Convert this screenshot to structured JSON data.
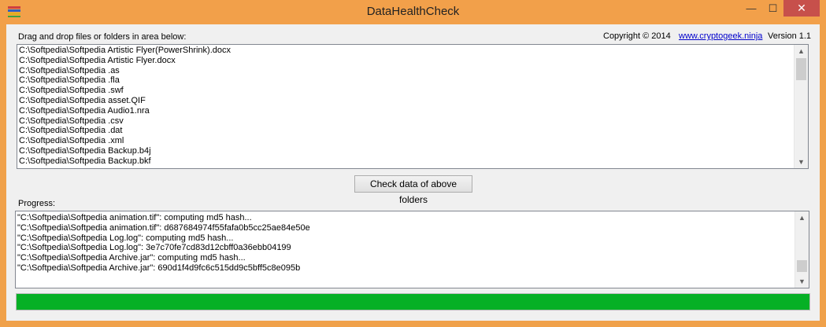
{
  "window": {
    "title": "DataHealthCheck",
    "minimize_glyph": "—",
    "maximize_glyph": "☐",
    "close_glyph": "✕",
    "close_color": "#c7504b",
    "frame_color": "#f0a14a"
  },
  "header": {
    "drag_label": "Drag and drop files or folders in area below:",
    "copyright": "Copyright © 2014",
    "link": "www.cryptogeek.ninja",
    "version": "Version 1.1"
  },
  "files": [
    "C:\\Softpedia\\Softpedia Artistic Flyer(PowerShrink).docx",
    "C:\\Softpedia\\Softpedia Artistic Flyer.docx",
    "C:\\Softpedia\\Softpedia .as",
    "C:\\Softpedia\\Softpedia .fla",
    "C:\\Softpedia\\Softpedia .swf",
    "C:\\Softpedia\\Softpedia asset.QIF",
    "C:\\Softpedia\\Softpedia Audio1.nra",
    "C:\\Softpedia\\Softpedia .csv",
    "C:\\Softpedia\\Softpedia .dat",
    "C:\\Softpedia\\Softpedia .xml",
    "C:\\Softpedia\\Softpedia Backup.b4j",
    "C:\\Softpedia\\Softpedia Backup.bkf"
  ],
  "check_button": "Check data of above folders",
  "progress_label": "Progress:",
  "progress_log": [
    "\"C:\\Softpedia\\Softpedia animation.tif\": computing md5 hash...",
    "\"C:\\Softpedia\\Softpedia animation.tif\": d687684974f55fafa0b5cc25ae84e50e",
    "\"C:\\Softpedia\\Softpedia Log.log\": computing md5 hash...",
    "\"C:\\Softpedia\\Softpedia Log.log\": 3e7c70fe7cd83d12cbff0a36ebb04199",
    "\"C:\\Softpedia\\Softpedia Archive.jar\": computing md5 hash...",
    "\"C:\\Softpedia\\Softpedia Archive.jar\": 690d1f4d9fc6c515dd9c5bff5c8e095b"
  ],
  "progress": {
    "fraction": 1.0,
    "color": "#06b025"
  },
  "icons": {
    "app": "app-icon",
    "scroll_up": "▲",
    "scroll_down": "▼"
  }
}
